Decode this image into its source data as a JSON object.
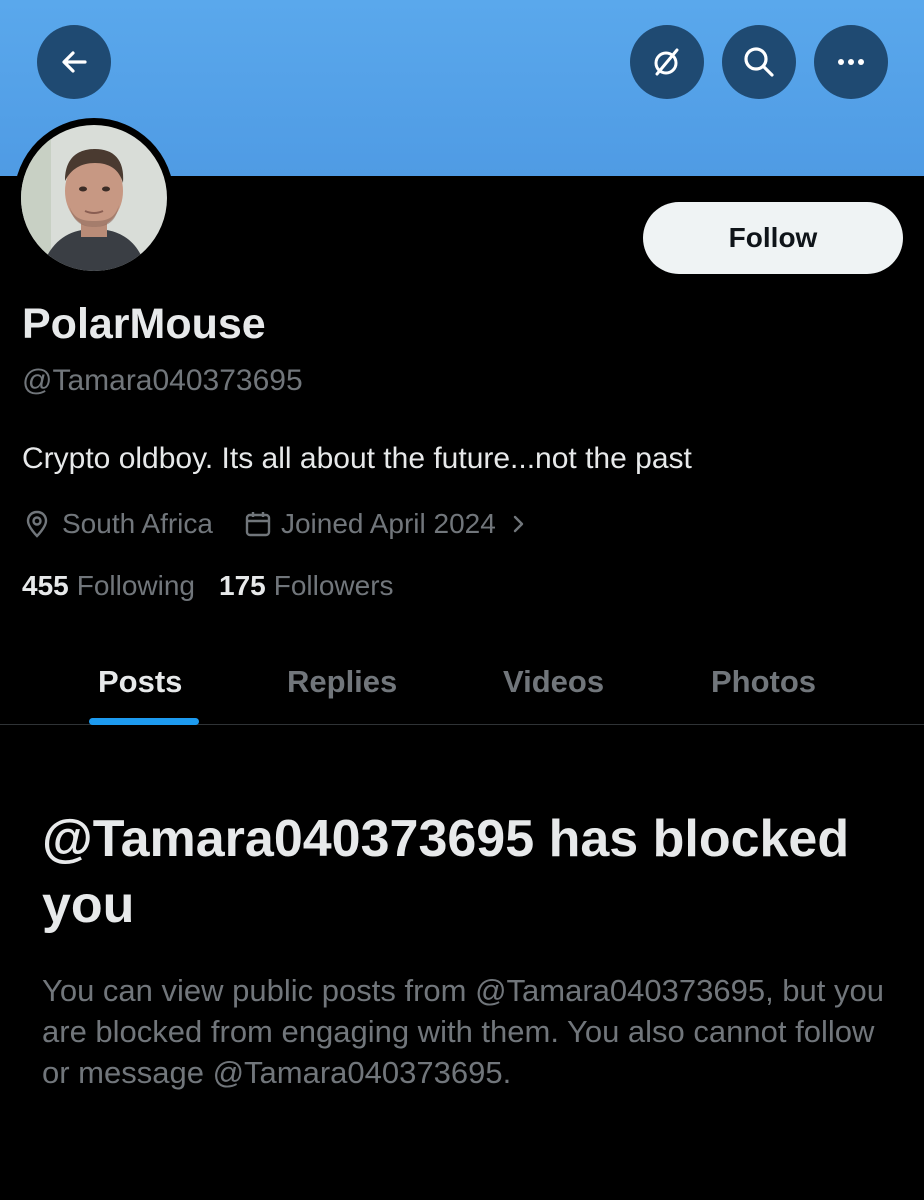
{
  "header": {
    "back_icon": "arrow-left-icon",
    "grok_icon": "grok-icon",
    "search_icon": "search-icon",
    "more_icon": "more-icon",
    "banner_color": "#5aa8ec"
  },
  "profile": {
    "display_name": "PolarMouse",
    "handle": "@Tamara040373695",
    "bio": "Crypto oldboy. Its all about the future...not the past",
    "location": "South Africa",
    "joined": "Joined April 2024",
    "following_count": "455",
    "following_label": "Following",
    "followers_count": "175",
    "followers_label": "Followers",
    "follow_label": "Follow"
  },
  "tabs": [
    {
      "label": "Posts",
      "active": true
    },
    {
      "label": "Replies",
      "active": false
    },
    {
      "label": "Videos",
      "active": false
    },
    {
      "label": "Photos",
      "active": false
    }
  ],
  "blocked": {
    "title": "@Tamara040373695 has blocked you",
    "body": "You can view public posts from @Tamara040373695, but you are blocked from engaging with them. You also cannot follow or message @Tamara040373695."
  },
  "colors": {
    "accent": "#1d9bf0",
    "muted": "#71767b",
    "text": "#e7e9ea",
    "background": "#000000"
  }
}
